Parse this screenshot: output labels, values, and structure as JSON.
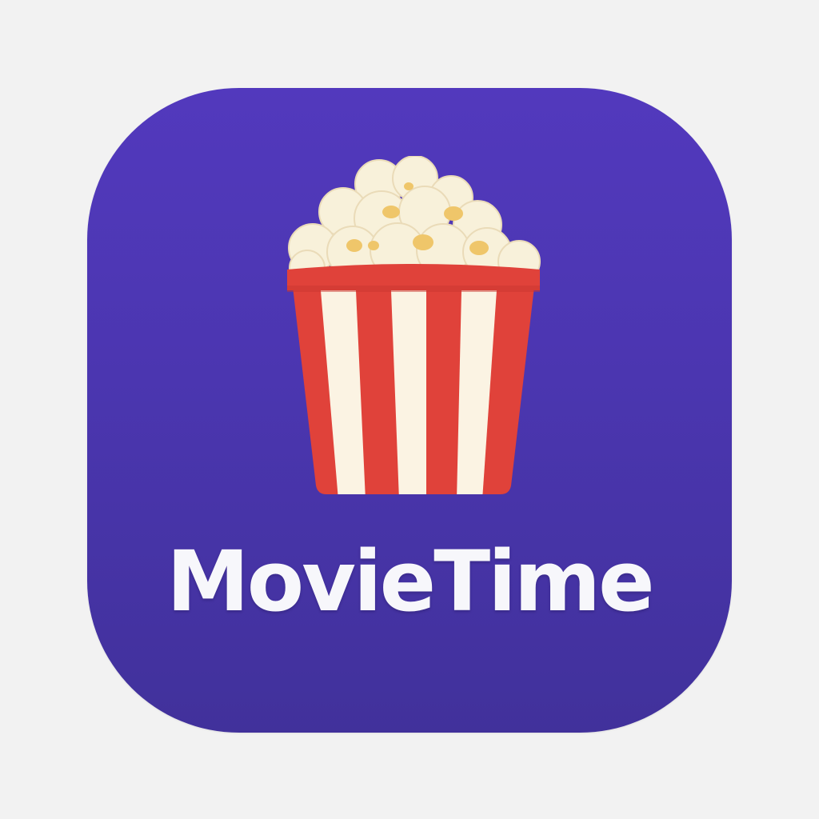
{
  "app": {
    "name": "MovieTime"
  },
  "icon": {
    "symbol": "popcorn-bucket-icon",
    "background_color": "#4b36b0",
    "stripe_red": "#e0423a",
    "stripe_cream": "#fbf3e3",
    "popcorn_color": "#f8f1da",
    "popcorn_accent": "#efc66a"
  }
}
